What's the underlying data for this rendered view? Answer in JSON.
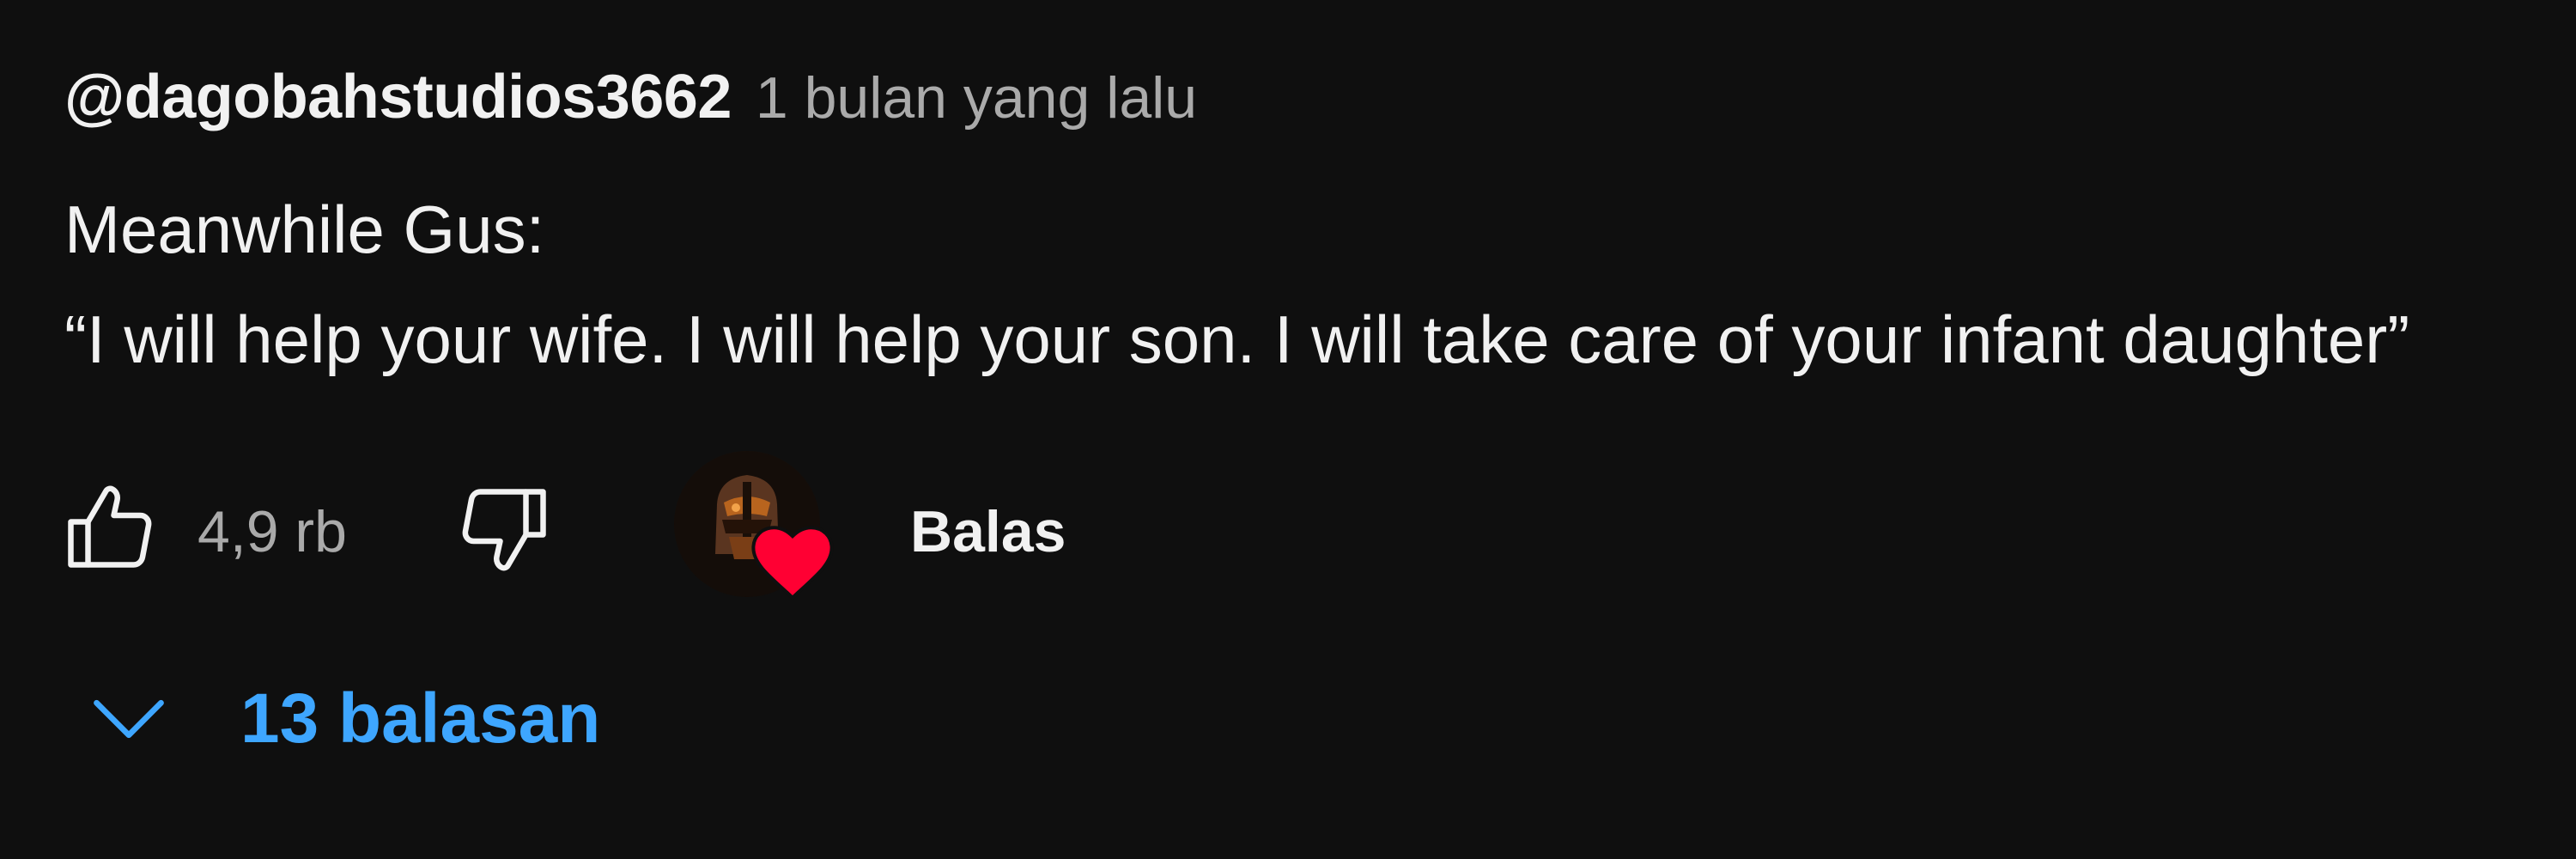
{
  "comment": {
    "author": "@dagobahstudios3662",
    "time": "1 bulan yang lalu",
    "text_lines": [
      "Meanwhile Gus:",
      "“I will help your wife. I will help your son. I will take care of your infant daughter”"
    ]
  },
  "actions": {
    "like_icon": "thumbs-up-icon",
    "like_count": "4,9 rb",
    "dislike_icon": "thumbs-down-icon",
    "creator_heart_icon": "heart-icon",
    "reply_label": "Balas"
  },
  "replies": {
    "toggle_icon": "chevron-down-icon",
    "label": "13 balasan"
  },
  "colors": {
    "background": "#0f0f0f",
    "text_primary": "#f1f1f1",
    "text_secondary": "#aaaaaa",
    "link_blue": "#3ea6ff",
    "heart_red": "#ff0033"
  }
}
